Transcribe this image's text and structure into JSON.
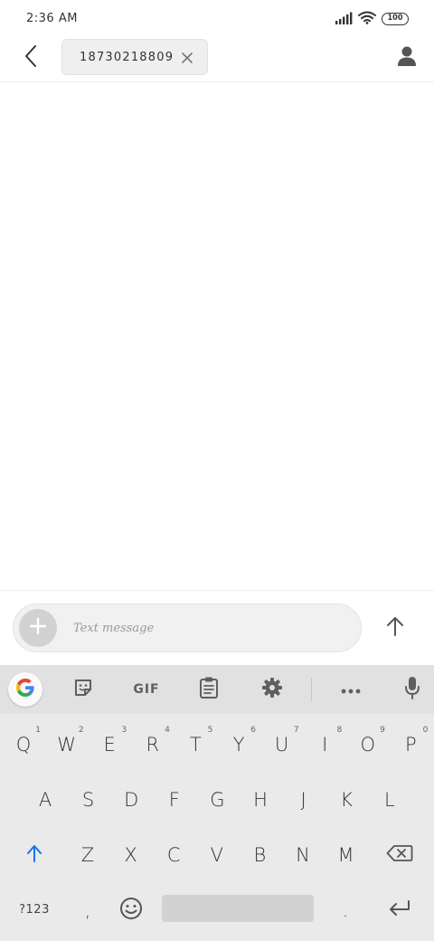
{
  "status_bar": {
    "time": "2:36 AM",
    "battery": "100"
  },
  "header": {
    "recipient": "18730218809"
  },
  "compose": {
    "placeholder": "Text message"
  },
  "keyboard": {
    "toolbar": {
      "gif_label": "GIF"
    },
    "rows": [
      [
        {
          "label": "Q",
          "hint": "1"
        },
        {
          "label": "W",
          "hint": "2"
        },
        {
          "label": "E",
          "hint": "3"
        },
        {
          "label": "R",
          "hint": "4"
        },
        {
          "label": "T",
          "hint": "5"
        },
        {
          "label": "Y",
          "hint": "6"
        },
        {
          "label": "U",
          "hint": "7"
        },
        {
          "label": "I",
          "hint": "8"
        },
        {
          "label": "O",
          "hint": "9"
        },
        {
          "label": "P",
          "hint": "0"
        }
      ],
      [
        {
          "label": "A"
        },
        {
          "label": "S"
        },
        {
          "label": "D"
        },
        {
          "label": "F"
        },
        {
          "label": "G"
        },
        {
          "label": "H"
        },
        {
          "label": "J"
        },
        {
          "label": "K"
        },
        {
          "label": "L"
        }
      ],
      [
        {
          "label": "Z"
        },
        {
          "label": "X"
        },
        {
          "label": "C"
        },
        {
          "label": "V"
        },
        {
          "label": "B"
        },
        {
          "label": "N"
        },
        {
          "label": "M"
        }
      ]
    ],
    "symbols_label": "?123",
    "comma": ",",
    "period": "."
  },
  "colors": {
    "shift_accent": "#1a73e8",
    "keyboard_bg": "#eaeaea",
    "toolbar_bg": "#e1e1e1"
  },
  "icons": {
    "back": "chevron-left-icon",
    "chip_close": "close-icon",
    "contact": "person-icon",
    "attach": "plus-icon",
    "send": "arrow-up-icon",
    "google": "google-g-icon",
    "sticker": "sticker-icon",
    "clipboard": "clipboard-icon",
    "settings": "gear-icon",
    "more": "more-horizontal-icon",
    "mic": "microphone-icon",
    "shift": "shift-arrow-icon",
    "backspace": "backspace-icon",
    "emoji": "emoji-icon",
    "enter": "enter-icon"
  }
}
